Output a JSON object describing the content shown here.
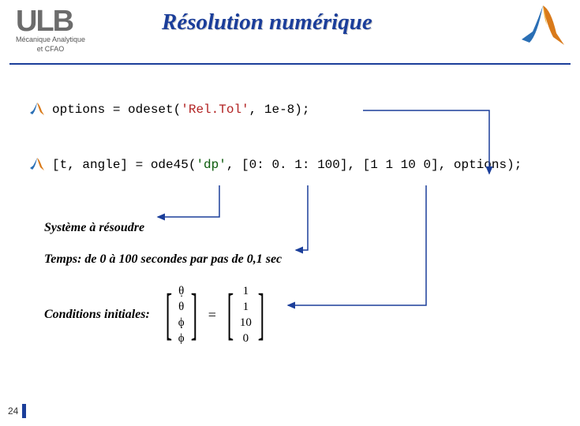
{
  "header": {
    "logo_text": "ULB",
    "logo_sub1": "Mécanique Analytique",
    "logo_sub2": "et CFAO",
    "title": "Résolution numérique"
  },
  "code": {
    "line1_a": "options = odeset(",
    "line1_b": "'Rel.Tol'",
    "line1_c": ", 1e-8);",
    "line2_a": "[t, angle] = ode45(",
    "line2_b": "'dp'",
    "line2_c": ", [0: 0. 1: 100], [1 1 10 0], options);"
  },
  "labels": {
    "l1": "Système à résoudre",
    "l2": "Temps: de 0 à 100 secondes par pas de 0,1 sec",
    "l3": "Conditions initiales:"
  },
  "vector": {
    "sym1": "θ",
    "sym2": "θ",
    "sym3": "ϕ",
    "sym4": "ϕ",
    "val1": "1",
    "val2": "1",
    "val3": "10",
    "val4": "0"
  },
  "page": "24"
}
